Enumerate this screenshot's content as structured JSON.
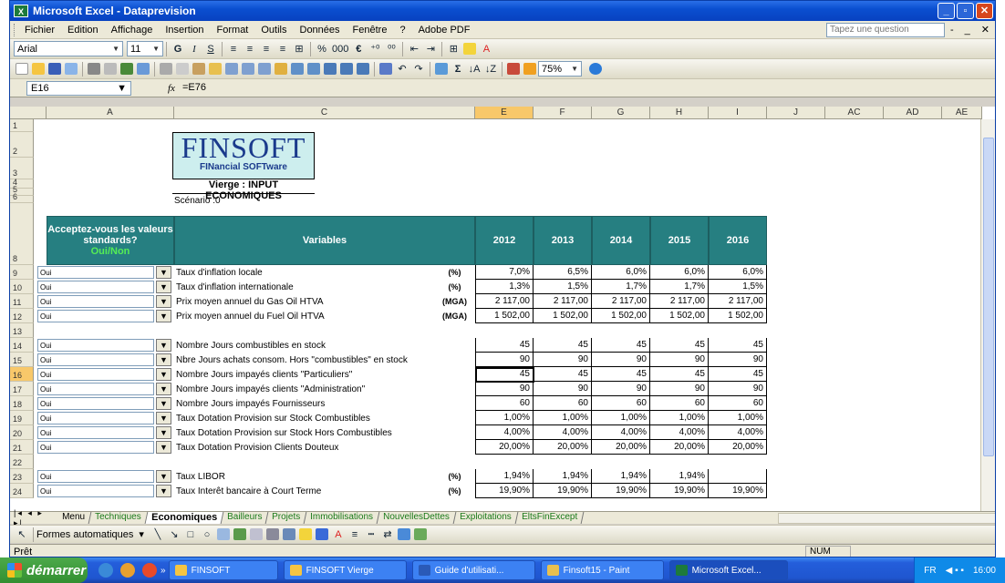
{
  "window": {
    "title": "Microsoft Excel - Dataprevision",
    "minimize": "_",
    "restore": "▫",
    "close": "✕"
  },
  "menu": {
    "items": [
      "Fichier",
      "Edition",
      "Affichage",
      "Insertion",
      "Format",
      "Outils",
      "Données",
      "Fenêtre",
      "?",
      "Adobe PDF"
    ],
    "question_placeholder": "Tapez une question",
    "win_controls": [
      "-",
      "_ ",
      "✕"
    ]
  },
  "toolbar": {
    "font": "Arial",
    "size": "11",
    "bold": "G",
    "italic": "I",
    "underline": "S",
    "percent": "%",
    "thousands": "000",
    "euro": "€",
    "zoom": "75%"
  },
  "formula": {
    "cell_ref": "E16",
    "fx": "fx",
    "content": "=E76"
  },
  "columns": [
    "A",
    "C",
    "E",
    "F",
    "G",
    "H",
    "I",
    "J",
    "AC",
    "AD",
    "AE"
  ],
  "rows": [
    "1",
    "2",
    "3",
    "4",
    "5",
    "6",
    "8",
    "9",
    "10",
    "11",
    "12",
    "13",
    "14",
    "15",
    "16",
    "17",
    "18",
    "19",
    "20",
    "21",
    "22",
    "23",
    "24"
  ],
  "logo": {
    "title": "FINSOFT",
    "subtitle": "FINancial SOFTware"
  },
  "sheet_title": "Vierge : INPUT ECONOMIQUES",
  "scenario": "Scénario :0",
  "table": {
    "header_question": "Acceptez-vous les valeurs standards?",
    "header_oui_non": "Oui/Non",
    "header_variables": "Variables",
    "years": [
      "2012",
      "2013",
      "2014",
      "2015",
      "2016"
    ],
    "rows": [
      {
        "choice": "Oui",
        "label": "Taux d'inflation locale",
        "unit": "(%)",
        "values": [
          "7,0%",
          "6,5%",
          "6,0%",
          "6,0%",
          "6,0%"
        ]
      },
      {
        "choice": "Oui",
        "label": "Taux d'inflation internationale",
        "unit": "(%)",
        "values": [
          "1,3%",
          "1,5%",
          "1,7%",
          "1,7%",
          "1,5%"
        ]
      },
      {
        "choice": "Oui",
        "label": "Prix moyen annuel du Gas Oil HTVA",
        "unit": "(MGA)",
        "values": [
          "2 117,00",
          "2 117,00",
          "2 117,00",
          "2 117,00",
          "2 117,00"
        ]
      },
      {
        "choice": "Oui",
        "label": "Prix moyen annuel du Fuel Oil HTVA",
        "unit": "(MGA)",
        "values": [
          "1 502,00",
          "1 502,00",
          "1 502,00",
          "1 502,00",
          "1 502,00"
        ]
      },
      {
        "choice": "",
        "label": "",
        "unit": "",
        "values": [
          "",
          "",
          "",
          "",
          ""
        ]
      },
      {
        "choice": "Oui",
        "label": "Nombre Jours combustibles en stock",
        "unit": "",
        "values": [
          "45",
          "45",
          "45",
          "45",
          "45"
        ]
      },
      {
        "choice": "Oui",
        "label": "Nbre Jours achats consom. Hors \"combustibles\"  en stock",
        "unit": "",
        "values": [
          "90",
          "90",
          "90",
          "90",
          "90"
        ]
      },
      {
        "choice": "Oui",
        "label": "Nombre Jours impayés clients \"Particuliers\"",
        "unit": "",
        "values": [
          "45",
          "45",
          "45",
          "45",
          "45"
        ]
      },
      {
        "choice": "Oui",
        "label": "Nombre Jours impayés clients \"Administration\"",
        "unit": "",
        "values": [
          "90",
          "90",
          "90",
          "90",
          "90"
        ]
      },
      {
        "choice": "Oui",
        "label": "Nombre Jours impayés Fournisseurs",
        "unit": "",
        "values": [
          "60",
          "60",
          "60",
          "60",
          "60"
        ]
      },
      {
        "choice": "Oui",
        "label": "Taux Dotation Provision sur Stock Combustibles",
        "unit": "",
        "values": [
          "1,00%",
          "1,00%",
          "1,00%",
          "1,00%",
          "1,00%"
        ]
      },
      {
        "choice": "Oui",
        "label": "Taux Dotation Provision sur Stock Hors Combustibles",
        "unit": "",
        "values": [
          "4,00%",
          "4,00%",
          "4,00%",
          "4,00%",
          "4,00%"
        ]
      },
      {
        "choice": "Oui",
        "label": "Taux Dotation Provision Clients Douteux",
        "unit": "",
        "values": [
          "20,00%",
          "20,00%",
          "20,00%",
          "20,00%",
          "20,00%"
        ]
      },
      {
        "choice": "",
        "label": "",
        "unit": "",
        "values": [
          "",
          "",
          "",
          "",
          ""
        ]
      },
      {
        "choice": "Oui",
        "label": "Taux LIBOR",
        "unit": "(%)",
        "values": [
          "1,94%",
          "1,94%",
          "1,94%",
          "1,94%",
          ""
        ]
      },
      {
        "choice": "Oui",
        "label": "Taux Interêt bancaire à Court Terme",
        "unit": "(%)",
        "values": [
          "19,90%",
          "19,90%",
          "19,90%",
          "19,90%",
          "19,90%"
        ]
      }
    ]
  },
  "sheet_tabs": [
    {
      "label": "Menu",
      "style": "plain"
    },
    {
      "label": "Techniques",
      "style": "green"
    },
    {
      "label": "Economiques",
      "style": "active"
    },
    {
      "label": "Bailleurs",
      "style": "green"
    },
    {
      "label": "Projets",
      "style": "green"
    },
    {
      "label": "Immobilisations",
      "style": "green"
    },
    {
      "label": "NouvellesDettes",
      "style": "green"
    },
    {
      "label": "Exploitations",
      "style": "green"
    },
    {
      "label": "EltsFinExcept",
      "style": "green"
    }
  ],
  "drawbar": {
    "autoshapes": "Formes automatiques"
  },
  "status": {
    "ready": "Prêt",
    "num": "NUM"
  },
  "taskbar": {
    "start": "démarrer",
    "tasks": [
      "FINSOFT",
      "FINSOFT Vierge",
      "Guide d'utilisati...",
      "Finsoft15 - Paint",
      "Microsoft Excel..."
    ],
    "lang": "FR",
    "clock": "16:00"
  }
}
